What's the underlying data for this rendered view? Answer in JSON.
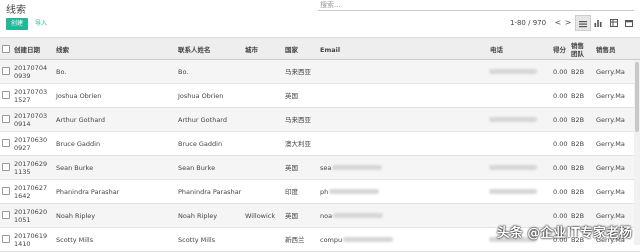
{
  "header": {
    "title": "线索",
    "search_placeholder": "搜索...",
    "create_label": "创建",
    "import_label": "导入",
    "pager": "1-80 / 970",
    "pager_prev": "<",
    "pager_next": ">"
  },
  "columns": [
    "创建日期",
    "线索",
    "联系人姓名",
    "城市",
    "国家",
    "Email",
    "电话",
    "得分",
    "销售团队",
    "销售员"
  ],
  "rows": [
    {
      "date": "20170704\n0939",
      "lead": "Bo.",
      "contact": "Bo.",
      "city": "",
      "country": "马来西亚",
      "email": "",
      "phone_blurred": true,
      "score": "0.00",
      "team": "B2B",
      "salesperson": "Gerry.Ma"
    },
    {
      "date": "20170703\n1527",
      "lead": "Joshua Obrien",
      "contact": "Joshua Obrien",
      "city": "",
      "country": "英国",
      "email": "",
      "phone_blurred": false,
      "score": "0.00",
      "team": "B2B",
      "salesperson": "Gerry.Ma"
    },
    {
      "date": "20170703\n0914",
      "lead": "Arthur Gothard",
      "contact": "Arthur Gothard",
      "city": "",
      "country": "马来西亚",
      "email": "",
      "phone_blurred": true,
      "score": "0.00",
      "team": "B2B",
      "salesperson": "Gerry.Ma"
    },
    {
      "date": "20170630\n0927",
      "lead": "Bruce Gaddin",
      "contact": "Bruce Gaddin",
      "city": "",
      "country": "澳大利亚",
      "email": "",
      "phone_blurred": false,
      "score": "0.00",
      "team": "B2B",
      "salesperson": "Gerry.Ma"
    },
    {
      "date": "20170629\n1135",
      "lead": "Sean Burke",
      "contact": "Sean Burke",
      "city": "",
      "country": "英国",
      "email": "sea",
      "phone_blurred": true,
      "score": "0.00",
      "team": "B2B",
      "salesperson": "Gerry.Ma"
    },
    {
      "date": "20170627\n1642",
      "lead": "Phanindra Parashar",
      "contact": "Phanindra Parashar",
      "city": "",
      "country": "印度",
      "email": "ph",
      "phone_blurred": true,
      "score": "0.00",
      "team": "B2B",
      "salesperson": "Gerry.Ma"
    },
    {
      "date": "20170620\n1051",
      "lead": "Noah Ripley",
      "contact": "Noah Ripley",
      "city": "Willowick",
      "country": "英国",
      "email": "noa",
      "phone_blurred": false,
      "score": "0.00",
      "team": "B2B",
      "salesperson": "Gerry.Ma"
    },
    {
      "date": "20170619\n1410",
      "lead": "Scotty Mills",
      "contact": "Scotty Mills",
      "city": "",
      "country": "新西兰",
      "email": "compu",
      "phone_blurred": true,
      "score": "0.00",
      "team": "B2B",
      "salesperson": "Gerry.Ma"
    }
  ],
  "watermark": "头条 @企业IT专家老杨",
  "icons": {
    "list_view": "list-icon",
    "graph_view": "bar-chart-icon",
    "pivot_view": "table-icon",
    "calendar_view": "calendar-icon"
  },
  "colors": {
    "primary": "#21b799",
    "header_bg": "#eeeeee"
  }
}
